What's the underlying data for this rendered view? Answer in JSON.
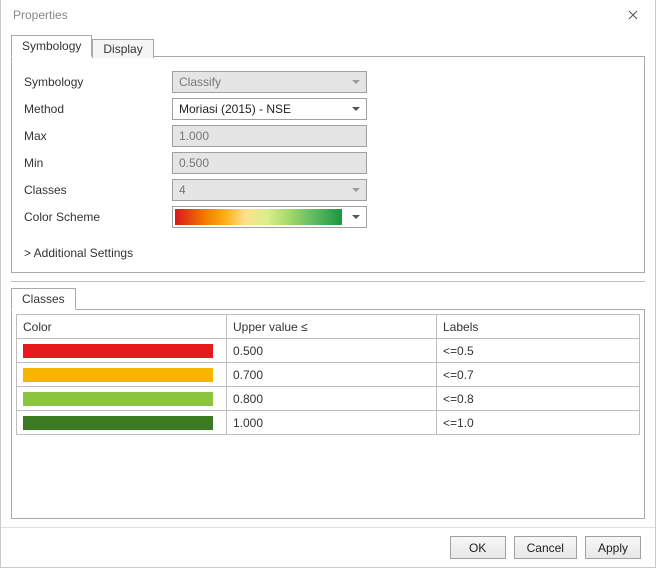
{
  "window": {
    "title": "Properties"
  },
  "tabs": {
    "symbology": "Symbology",
    "display": "Display"
  },
  "form": {
    "symbology_label": "Symbology",
    "symbology_value": "Classify",
    "method_label": "Method",
    "method_value": "Moriasi (2015) - NSE",
    "max_label": "Max",
    "max_value": "1.000",
    "min_label": "Min",
    "min_value": "0.500",
    "classes_label": "Classes",
    "classes_value": "4",
    "colorscheme_label": "Color Scheme",
    "additional": "> Additional Settings"
  },
  "classes_section": {
    "tab": "Classes",
    "headers": {
      "color": "Color",
      "upper": "Upper value ≤",
      "labels": "Labels"
    },
    "rows": [
      {
        "color": "#e41a1c",
        "upper": "0.500",
        "label": "<=0.5"
      },
      {
        "color": "#f8b500",
        "upper": "0.700",
        "label": "<=0.7"
      },
      {
        "color": "#8bc53f",
        "upper": "0.800",
        "label": "<=0.8"
      },
      {
        "color": "#3b7a23",
        "upper": "1.000",
        "label": "<=1.0"
      }
    ]
  },
  "buttons": {
    "ok": "OK",
    "cancel": "Cancel",
    "apply": "Apply"
  }
}
